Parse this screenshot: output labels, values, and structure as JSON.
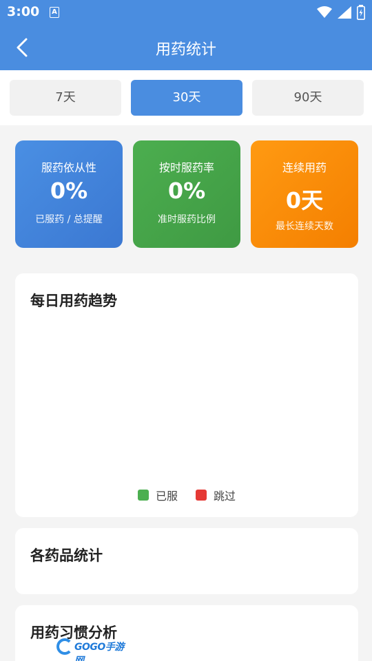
{
  "status_bar": {
    "time": "3:00",
    "notification_icon": "A"
  },
  "header": {
    "title": "用药统计"
  },
  "tabs": [
    {
      "label": "7天",
      "selected": false
    },
    {
      "label": "30天",
      "selected": true
    },
    {
      "label": "90天",
      "selected": false
    }
  ],
  "stats": [
    {
      "label": "服药依从性",
      "value": "0%",
      "sub": "已服药 / 总提醒",
      "color": "#4a8de0"
    },
    {
      "label": "按时服药率",
      "value": "0%",
      "sub": "准时服药比例",
      "color": "#4caf50"
    },
    {
      "label": "连续用药",
      "value": "0天",
      "sub": "最长连续天数",
      "color": "#ff9800"
    }
  ],
  "trend": {
    "title": "每日用药趋势",
    "legend": [
      {
        "label": "已服",
        "color": "#4caf50"
      },
      {
        "label": "跳过",
        "color": "#e53935"
      }
    ]
  },
  "drug_stats": {
    "title": "各药品统计"
  },
  "habit": {
    "title": "用药习惯分析"
  },
  "watermark": {
    "text": "GOGO手游网"
  }
}
